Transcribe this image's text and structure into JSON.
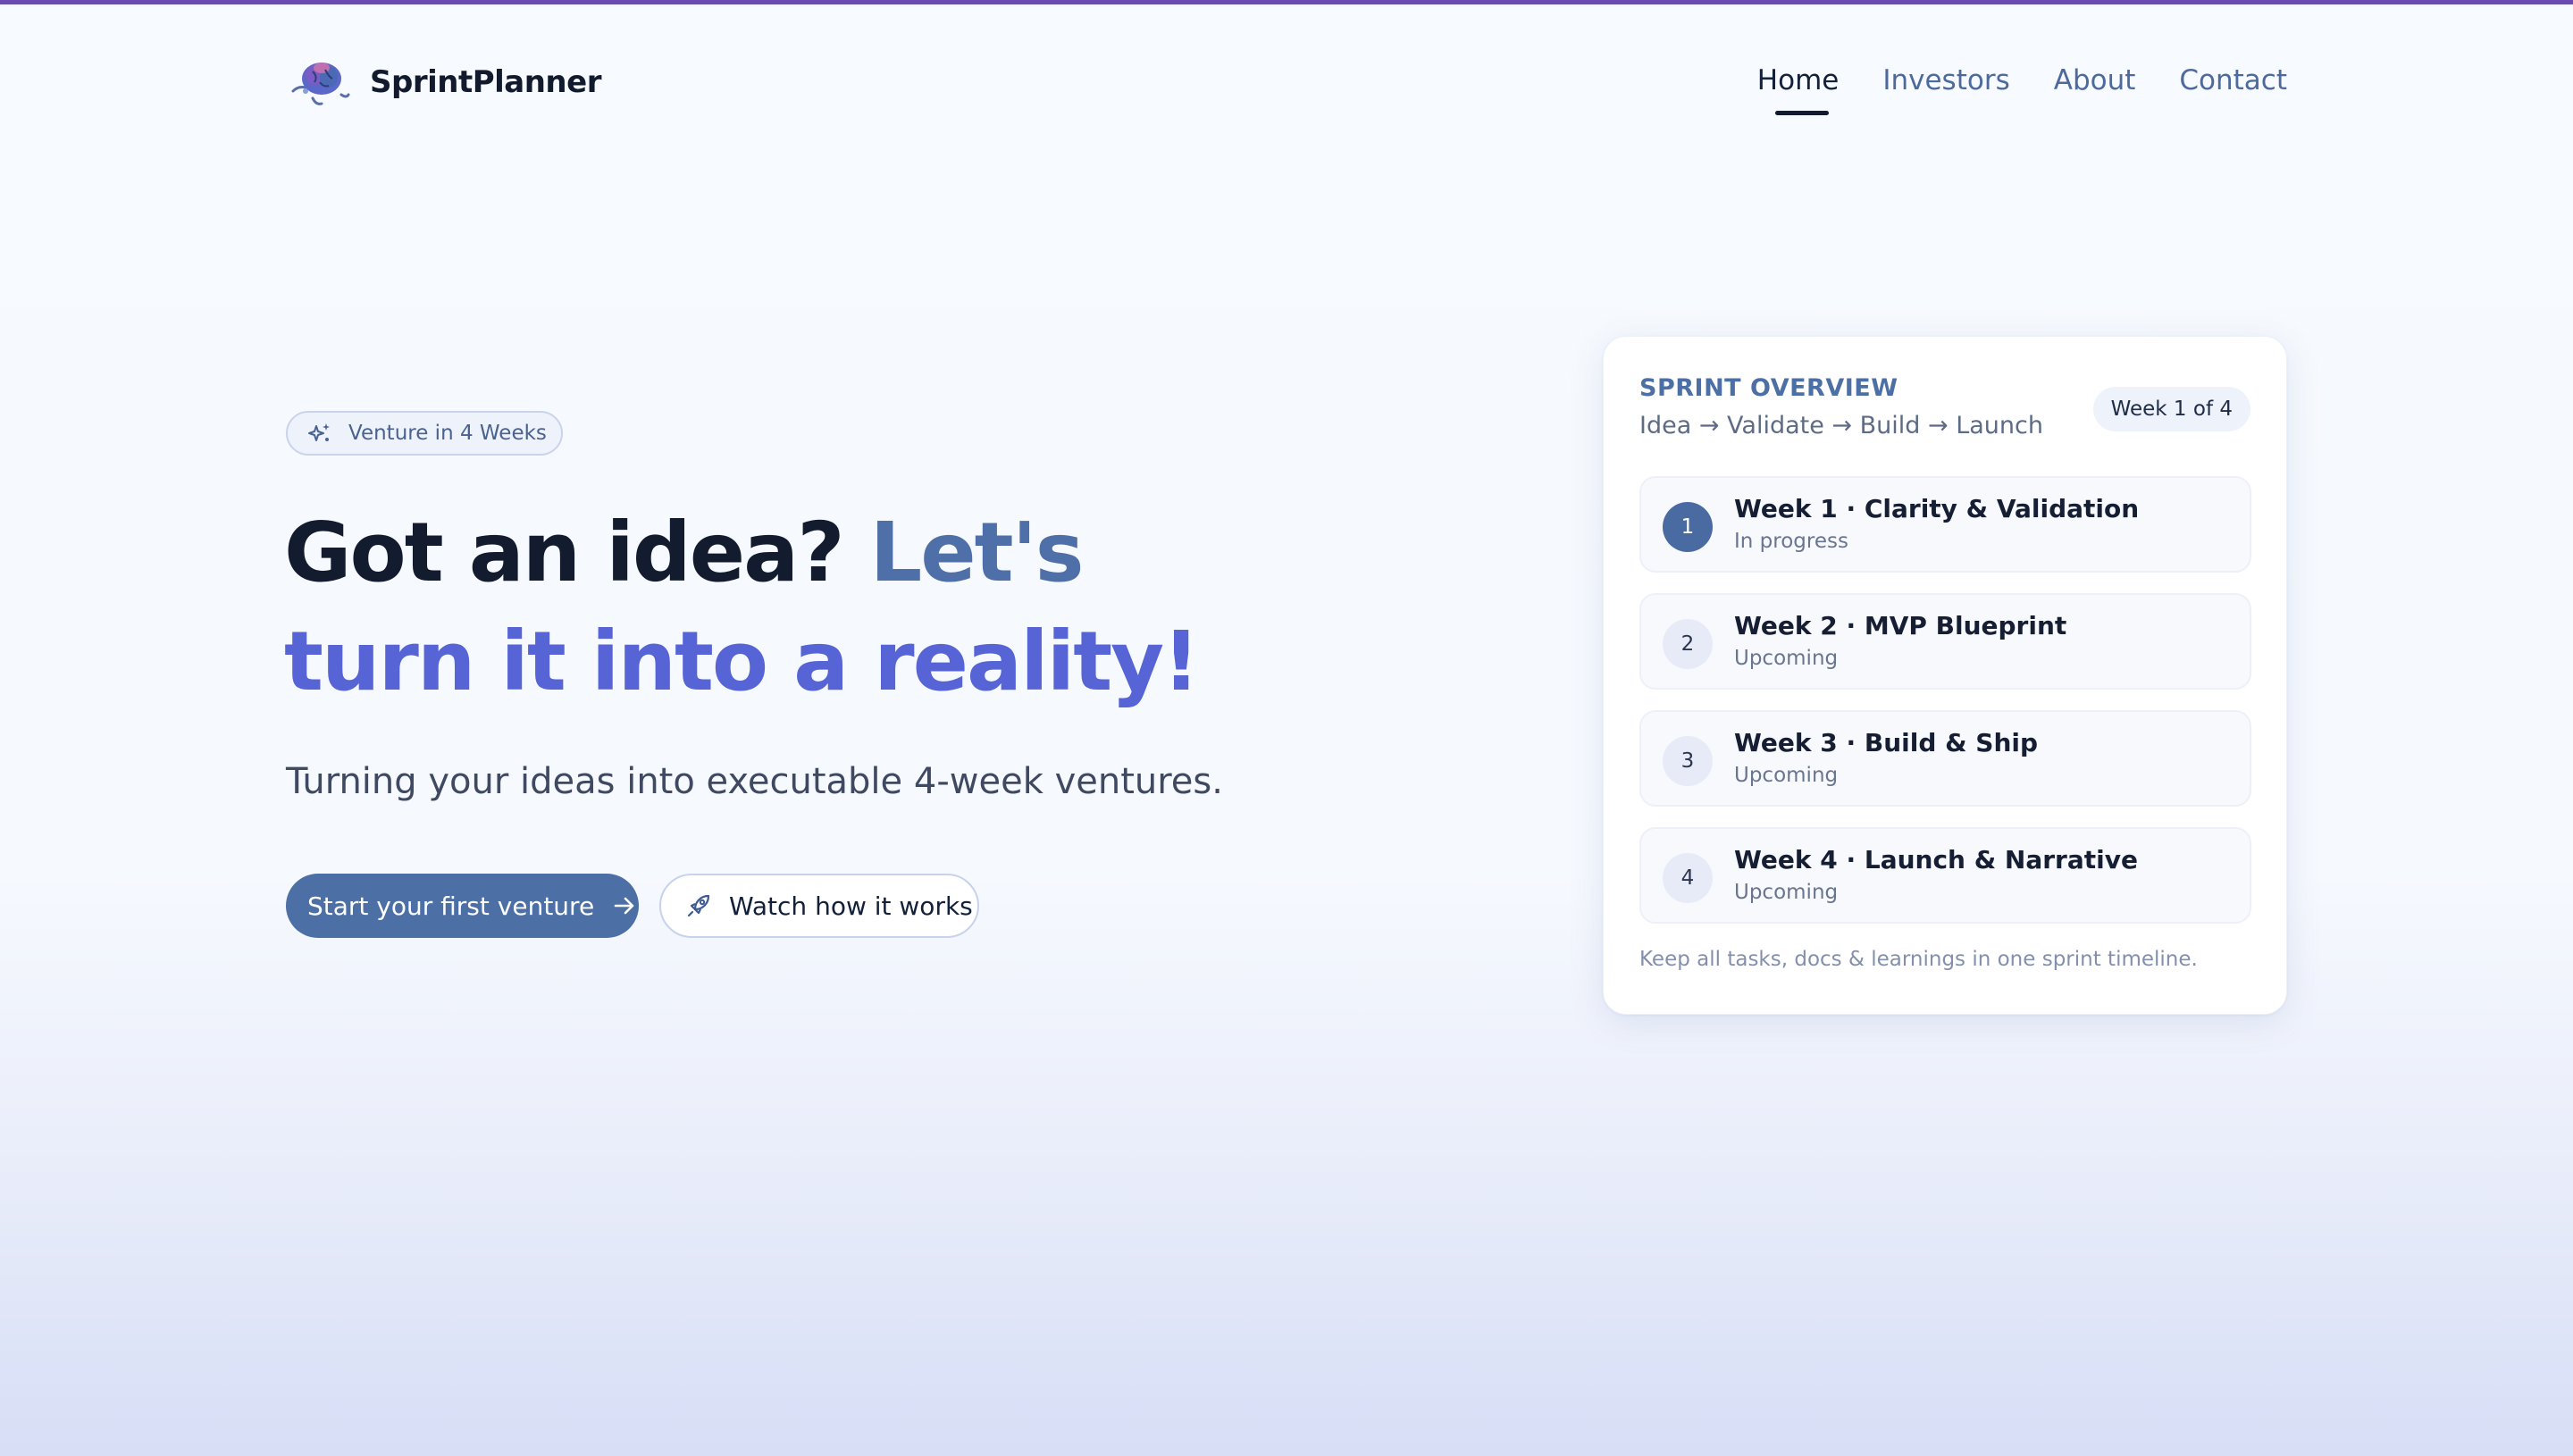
{
  "brand": {
    "name": "SprintPlanner",
    "logo_icon": "brain-icon"
  },
  "nav": {
    "items": [
      {
        "label": "Home",
        "active": true
      },
      {
        "label": "Investors",
        "active": false
      },
      {
        "label": "About",
        "active": false
      },
      {
        "label": "Contact",
        "active": false
      }
    ]
  },
  "hero": {
    "badge": {
      "icon": "sparkles-icon",
      "label": "Venture in 4 Weeks"
    },
    "headline": {
      "part1": "Got an idea?",
      "part2": "Let's",
      "part3": "turn it into a reality!"
    },
    "subtitle": "Turning your ideas into executable 4-week ventures.",
    "primary_cta": {
      "label": "Start your first venture",
      "icon": "arrow-right-icon"
    },
    "secondary_cta": {
      "label": "Watch how it works",
      "icon": "rocket-icon"
    }
  },
  "sprint_card": {
    "title": "SPRINT OVERVIEW",
    "flow": "Idea → Validate → Build → Launch",
    "week_indicator": "Week 1 of 4",
    "weeks": [
      {
        "number": "1",
        "title": "Week 1 · Clarity & Validation",
        "status": "In progress"
      },
      {
        "number": "2",
        "title": "Week 2 · MVP Blueprint",
        "status": "Upcoming"
      },
      {
        "number": "3",
        "title": "Week 3 · Build & Ship",
        "status": "Upcoming"
      },
      {
        "number": "4",
        "title": "Week 4 · Launch & Narrative",
        "status": "Upcoming"
      }
    ],
    "footer": "Keep all tasks, docs & learnings in one sprint timeline."
  },
  "colors": {
    "accent": "#4c6fa5",
    "violet": "#5664d6",
    "topbar": "#6a4bb0",
    "text_dark": "#131b2e"
  }
}
